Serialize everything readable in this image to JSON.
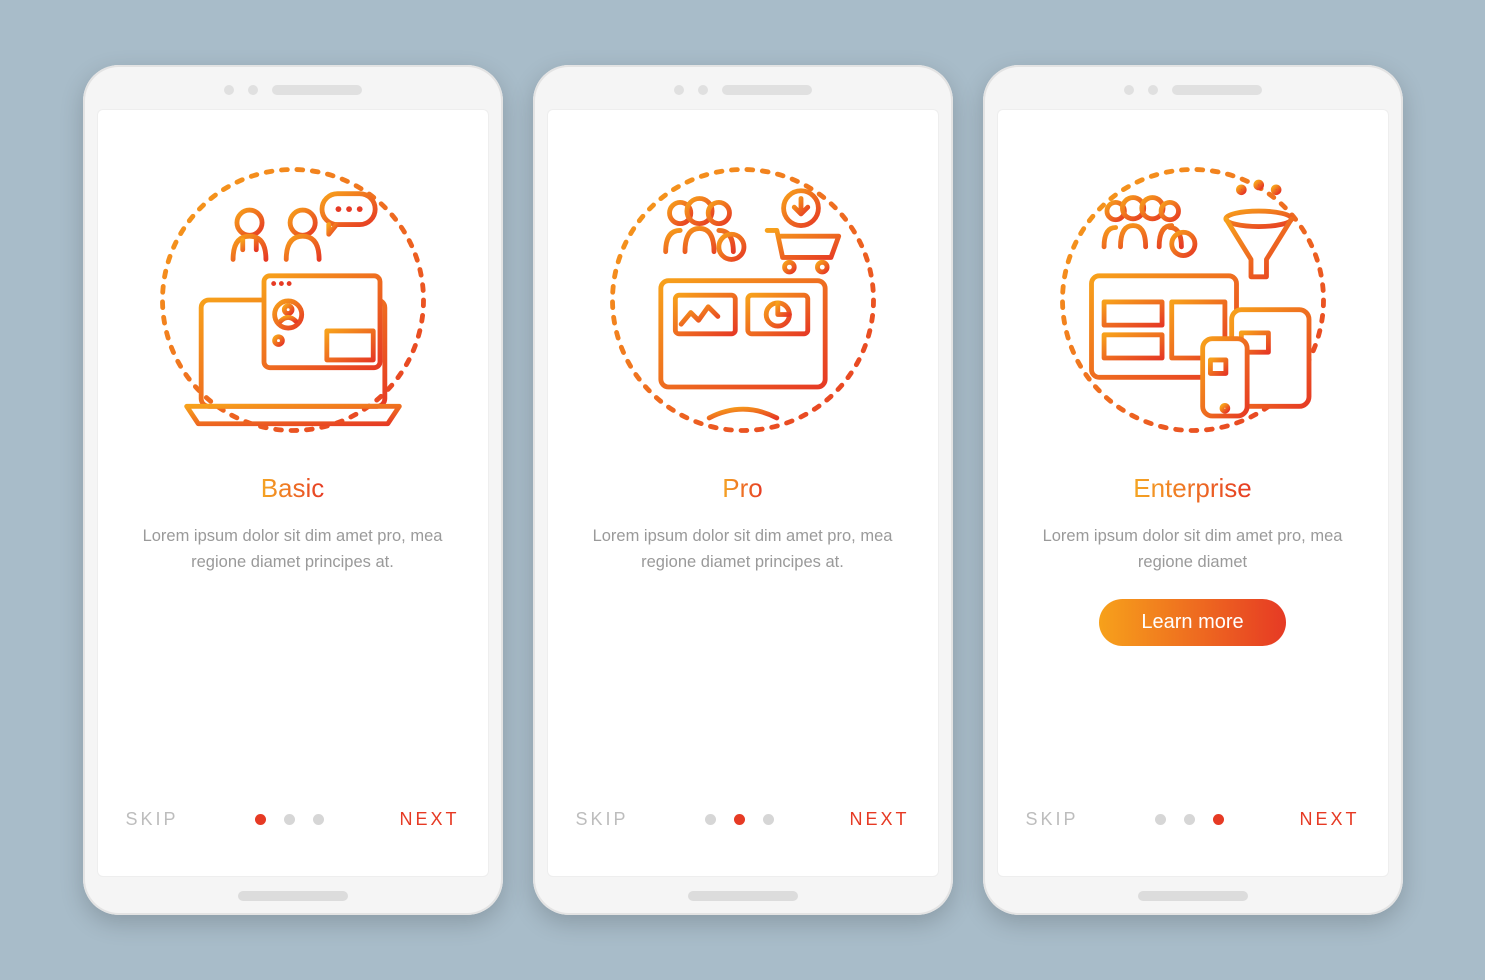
{
  "colors": {
    "accent_start": "#f7a11b",
    "accent_end": "#e63a24",
    "muted": "#bdbdbd",
    "desc": "#9a9a9a"
  },
  "screens": [
    {
      "title": "Basic",
      "description": "Lorem ipsum dolor sit dim amet pro, mea regione diamet principes at.",
      "skip_label": "SKIP",
      "next_label": "NEXT",
      "active_dot": 0,
      "illustration": "basic-illustration",
      "has_cta": false
    },
    {
      "title": "Pro",
      "description": "Lorem ipsum dolor sit dim amet pro, mea regione diamet principes at.",
      "skip_label": "SKIP",
      "next_label": "NEXT",
      "active_dot": 1,
      "illustration": "pro-illustration",
      "has_cta": false
    },
    {
      "title": "Enterprise",
      "description": "Lorem ipsum dolor sit dim amet pro, mea regione diamet",
      "skip_label": "SKIP",
      "next_label": "NEXT",
      "active_dot": 2,
      "illustration": "enterprise-illustration",
      "has_cta": true,
      "cta_label": "Learn more"
    }
  ],
  "dot_count": 3
}
